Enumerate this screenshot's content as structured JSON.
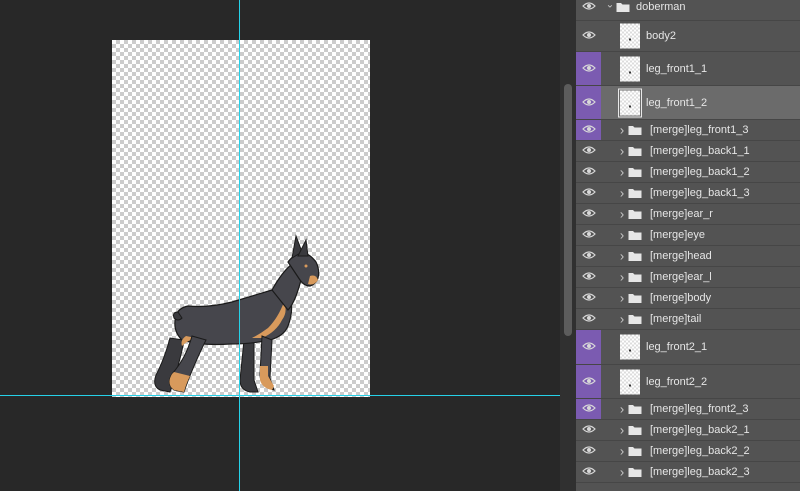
{
  "colors": {
    "guide": "#26d1e8",
    "clip_indicator": "#7b5bb1",
    "panel_bg": "#535353",
    "selected_row": "#6b6b6b"
  },
  "layers": {
    "group": {
      "name": "doberman",
      "expanded": true
    },
    "items": [
      {
        "name": "body2",
        "kind": "layer",
        "clipped": false,
        "selected": false
      },
      {
        "name": "leg_front1_1",
        "kind": "layer",
        "clipped": true,
        "selected": false
      },
      {
        "name": "leg_front1_2",
        "kind": "layer",
        "clipped": true,
        "selected": true
      },
      {
        "name": "[merge]leg_front1_3",
        "kind": "group",
        "clipped": true,
        "selected": false
      },
      {
        "name": "[merge]leg_back1_1",
        "kind": "group",
        "clipped": false,
        "selected": false
      },
      {
        "name": "[merge]leg_back1_2",
        "kind": "group",
        "clipped": false,
        "selected": false
      },
      {
        "name": "[merge]leg_back1_3",
        "kind": "group",
        "clipped": false,
        "selected": false
      },
      {
        "name": "[merge]ear_r",
        "kind": "group",
        "clipped": false,
        "selected": false
      },
      {
        "name": "[merge]eye",
        "kind": "group",
        "clipped": false,
        "selected": false
      },
      {
        "name": "[merge]head",
        "kind": "group",
        "clipped": false,
        "selected": false
      },
      {
        "name": "[merge]ear_l",
        "kind": "group",
        "clipped": false,
        "selected": false
      },
      {
        "name": "[merge]body",
        "kind": "group",
        "clipped": false,
        "selected": false
      },
      {
        "name": "[merge]tail",
        "kind": "group",
        "clipped": false,
        "selected": false
      },
      {
        "name": "leg_front2_1",
        "kind": "layer",
        "clipped": true,
        "selected": false
      },
      {
        "name": "leg_front2_2",
        "kind": "layer",
        "clipped": true,
        "selected": false
      },
      {
        "name": "[merge]leg_front2_3",
        "kind": "group",
        "clipped": true,
        "selected": false
      },
      {
        "name": "[merge]leg_back2_1",
        "kind": "group",
        "clipped": false,
        "selected": false
      },
      {
        "name": "[merge]leg_back2_2",
        "kind": "group",
        "clipped": false,
        "selected": false
      },
      {
        "name": "[merge]leg_back2_3",
        "kind": "group",
        "clipped": false,
        "selected": false
      }
    ]
  },
  "icons": {
    "visibility": "eye-icon",
    "group": "folder-icon",
    "expand": "chevron-right-icon",
    "collapse": "chevron-down-icon"
  }
}
